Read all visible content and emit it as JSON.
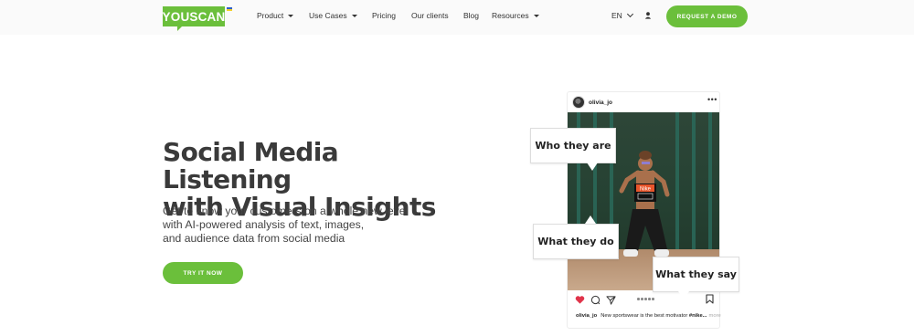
{
  "header": {
    "logo_text": "YOUSCAN",
    "nav": [
      {
        "label": "Product",
        "dropdown": true
      },
      {
        "label": "Use Cases",
        "dropdown": true
      },
      {
        "label": "Pricing",
        "dropdown": false
      },
      {
        "label": "Our clients",
        "dropdown": false
      },
      {
        "label": "Blog",
        "dropdown": false
      },
      {
        "label": "Resources",
        "dropdown": true
      }
    ],
    "language": "EN",
    "demo_button": "REQUEST A DEMO"
  },
  "hero": {
    "title_line1": "Social Media Listening",
    "title_line2": "with Visual Insights",
    "subtitle_line1": "Get to know your customers on a whole new level",
    "subtitle_line2": "with AI-powered analysis of text, images,",
    "subtitle_line3": "and audience data from social media",
    "cta": "TRY IT NOW"
  },
  "post": {
    "username": "olivia_jo",
    "shirt_label": "Nike",
    "bubbles": {
      "who": "Who they are",
      "do": "What they do",
      "say": "What they say"
    },
    "caption_user": "olivia_jo",
    "caption_text": "New sportswear is the best motivator",
    "caption_hashtag": "#nike...",
    "caption_more": "more"
  },
  "colors": {
    "brand_green": "#6bbf3b",
    "heart_red": "#e0344a"
  },
  "icons": {
    "user": "user-icon",
    "like": "heart-icon",
    "comment": "comment-icon",
    "share": "share-icon",
    "save": "bookmark-icon"
  }
}
